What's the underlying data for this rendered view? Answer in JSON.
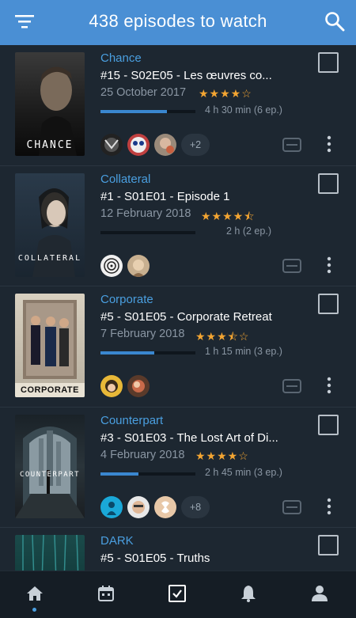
{
  "header": {
    "title": "438 episodes to watch"
  },
  "items": [
    {
      "show": "Chance",
      "episode": "#15 - S02E05 - Les  œuvres co...",
      "date": "25 October 2017",
      "stars": "★★★★☆",
      "progress": 0.7,
      "time_left": "4 h 30 min (6 ep.)",
      "poster_title": "CHANCE",
      "friends_more": "+2"
    },
    {
      "show": "Collateral",
      "episode": "#1 - S01E01 - Episode 1",
      "date": "12 February 2018",
      "stars": "★★★★⯪",
      "progress": 0.0,
      "time_left": "2 h (2 ep.)",
      "poster_title": "COLLATERAL",
      "friends_more": ""
    },
    {
      "show": "Corporate",
      "episode": "#5 - S01E05 - Corporate Retreat",
      "date": "7 February 2018",
      "stars": "★★★⯪☆",
      "progress": 0.57,
      "time_left": "1 h 15 min (3 ep.)",
      "poster_title": "CORPORATE",
      "friends_more": ""
    },
    {
      "show": "Counterpart",
      "episode": "#3 - S01E03 - The Lost Art of Di...",
      "date": "4 February 2018",
      "stars": "★★★★☆",
      "progress": 0.4,
      "time_left": "2 h 45 min (3 ep.)",
      "poster_title": "COUNTERPART",
      "friends_more": "+8"
    },
    {
      "show": "DARK",
      "episode": "#5 - S01E05 - Truths"
    }
  ],
  "tabs": [
    "home-icon",
    "calendar-icon",
    "checkbox-icon",
    "bell-icon",
    "user-icon"
  ],
  "colors": {
    "header": "#4a8fd4",
    "accent": "#4a9fe0",
    "stars": "#f3a532",
    "background": "#1d2731"
  }
}
